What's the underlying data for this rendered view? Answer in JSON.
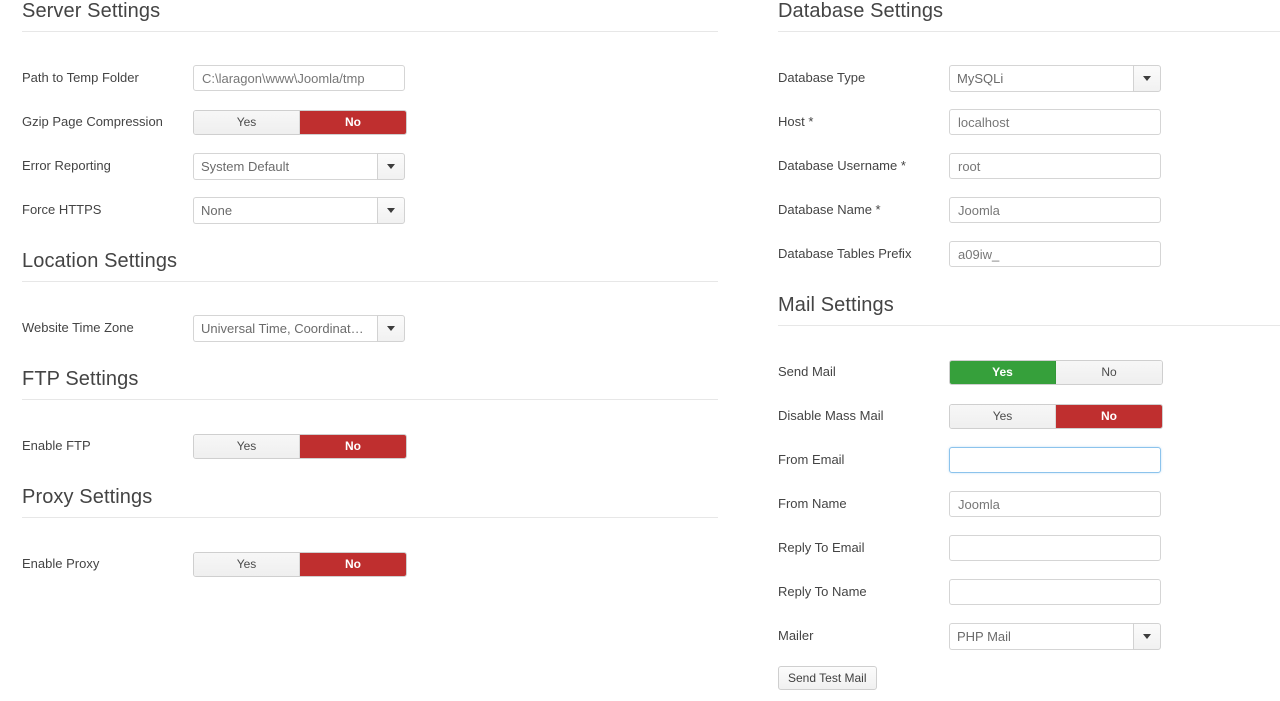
{
  "left_column": {
    "sections": [
      {
        "id": "server",
        "title": "Server Settings",
        "fields": [
          {
            "type": "text",
            "label": "Path to Temp Folder",
            "value": "C:\\laragon\\www\\Joomla/tmp"
          },
          {
            "type": "toggle",
            "label": "Gzip Page Compression",
            "yes_label": "Yes",
            "no_label": "No",
            "selected": "No",
            "accent": "#bf2f2f"
          },
          {
            "type": "select",
            "label": "Error Reporting",
            "value": "System Default"
          },
          {
            "type": "select",
            "label": "Force HTTPS",
            "value": "None"
          }
        ]
      },
      {
        "id": "location",
        "title": "Location Settings",
        "fields": [
          {
            "type": "select",
            "label": "Website Time Zone",
            "value": "Universal Time, Coordinated ..."
          }
        ]
      },
      {
        "id": "ftp",
        "title": "FTP Settings",
        "fields": [
          {
            "type": "toggle",
            "label": "Enable FTP",
            "yes_label": "Yes",
            "no_label": "No",
            "selected": "No",
            "accent": "#bf2f2f"
          }
        ]
      },
      {
        "id": "proxy",
        "title": "Proxy Settings",
        "fields": [
          {
            "type": "toggle",
            "label": "Enable Proxy",
            "yes_label": "Yes",
            "no_label": "No",
            "selected": "No",
            "accent": "#bf2f2f"
          }
        ]
      }
    ]
  },
  "right_column": {
    "sections": [
      {
        "id": "database",
        "title": "Database Settings",
        "fields": [
          {
            "type": "select",
            "label": "Database Type",
            "value": "MySQLi"
          },
          {
            "type": "text",
            "label": "Host *",
            "value": "localhost"
          },
          {
            "type": "text",
            "label": "Database Username *",
            "value": "root"
          },
          {
            "type": "text",
            "label": "Database Name *",
            "value": "Joomla"
          },
          {
            "type": "text",
            "label": "Database Tables Prefix",
            "value": "a09iw_"
          }
        ]
      },
      {
        "id": "mail",
        "title": "Mail Settings",
        "fields": [
          {
            "type": "toggle",
            "label": "Send Mail",
            "yes_label": "Yes",
            "no_label": "No",
            "selected": "Yes",
            "accent": "#36a03b"
          },
          {
            "type": "toggle",
            "label": "Disable Mass Mail",
            "yes_label": "Yes",
            "no_label": "No",
            "selected": "No",
            "accent": "#bf2f2f"
          },
          {
            "type": "text",
            "label": "From Email",
            "value": "",
            "focused": true
          },
          {
            "type": "text",
            "label": "From Name",
            "value": "Joomla"
          },
          {
            "type": "text",
            "label": "Reply To Email",
            "value": ""
          },
          {
            "type": "text",
            "label": "Reply To Name",
            "value": ""
          },
          {
            "type": "select",
            "label": "Mailer",
            "value": "PHP Mail"
          },
          {
            "type": "button",
            "label": "Send Test Mail",
            "name": "send-test-mail-button"
          }
        ]
      }
    ]
  },
  "icons": {
    "dropdown": "chevron-down-icon"
  },
  "colors": {
    "accent_red": "#bf2f2f",
    "accent_green": "#36a03b",
    "focus_blue": "#8cc3ec",
    "rule": "#e7e7e7",
    "text": "#444444"
  }
}
